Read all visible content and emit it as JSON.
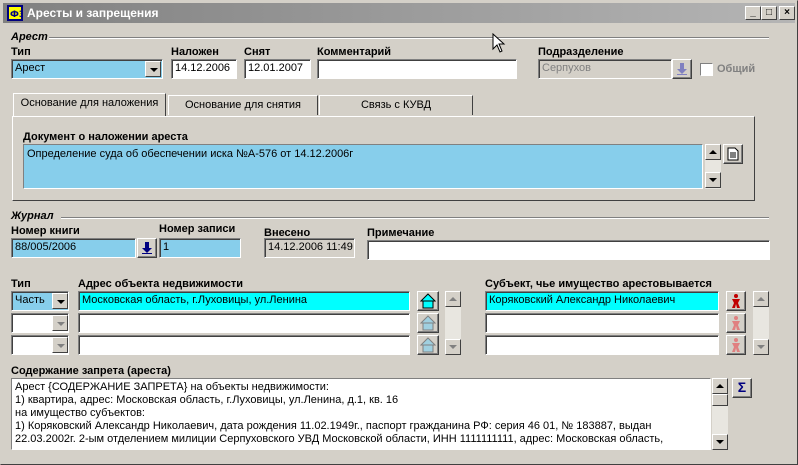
{
  "window": {
    "title": "Аресты и запрещения",
    "min": "_",
    "max": "□",
    "close": "×"
  },
  "arrest": {
    "group": "Арест",
    "type_label": "Тип",
    "type_value": "Арест",
    "imposed_label": "Наложен",
    "imposed_value": "14.12.2006",
    "removed_label": "Снят",
    "removed_value": "12.01.2007",
    "comment_label": "Комментарий",
    "comment_value": "",
    "division_label": "Подразделение",
    "division_value": "Серпухов",
    "common_label": "Общий"
  },
  "tabs": [
    {
      "label": "Основание для наложения"
    },
    {
      "label": "Основание для снятия"
    },
    {
      "label": "Связь с КУВД"
    }
  ],
  "tab_panel": {
    "doc_label": "Документ о наложении ареста",
    "doc_value": "Определение суда об обеспечении иска №А-576 от 14.12.2006г"
  },
  "journal": {
    "group": "Журнал",
    "book_label": "Номер книги",
    "book_value": "88/005/2006",
    "record_label": "Номер записи",
    "record_value": "1",
    "entered_label": "Внесено",
    "entered_value": "14.12.2006 11:49",
    "note_label": "Примечание",
    "note_value": ""
  },
  "objects": {
    "type_label": "Тип",
    "address_label": "Адрес объекта недвижимости",
    "rows": [
      {
        "type": "Часть",
        "address": "Московская область, г.Луховицы, ул.Ленина"
      },
      {
        "type": "",
        "address": ""
      },
      {
        "type": "",
        "address": ""
      }
    ]
  },
  "subjects": {
    "label": "Субъект, чье имущество арестовывается",
    "rows": [
      {
        "name": "Коряковский Александр Николаевич"
      },
      {
        "name": ""
      },
      {
        "name": ""
      }
    ]
  },
  "content": {
    "label": "Содержание запрета (ареста)",
    "lines": [
      "Арест {СОДЕРЖАНИЕ ЗАПРЕТА}  на объекты недвижимости:",
      "1) квартира, адрес: Московская область, г.Луховицы, ул.Ленина, д.1, кв. 16",
      "на имущество субъектов:",
      "1) Коряковский Александр Николаевич, дата рождения 11.02.1949г., паспорт гражданина РФ: серия 46 01, № 183887, выдан",
      "22.03.2002г. 2-ым отделением милиции Серпуховского УВД Московской области, ИНН 1111111111, адрес: Московская область,"
    ],
    "sigma": "Σ"
  },
  "colors": {
    "titlebar": "#808080",
    "selected_field": "#87ceeb",
    "highlight_field": "#00ffff",
    "face": "#d4d0c8"
  }
}
